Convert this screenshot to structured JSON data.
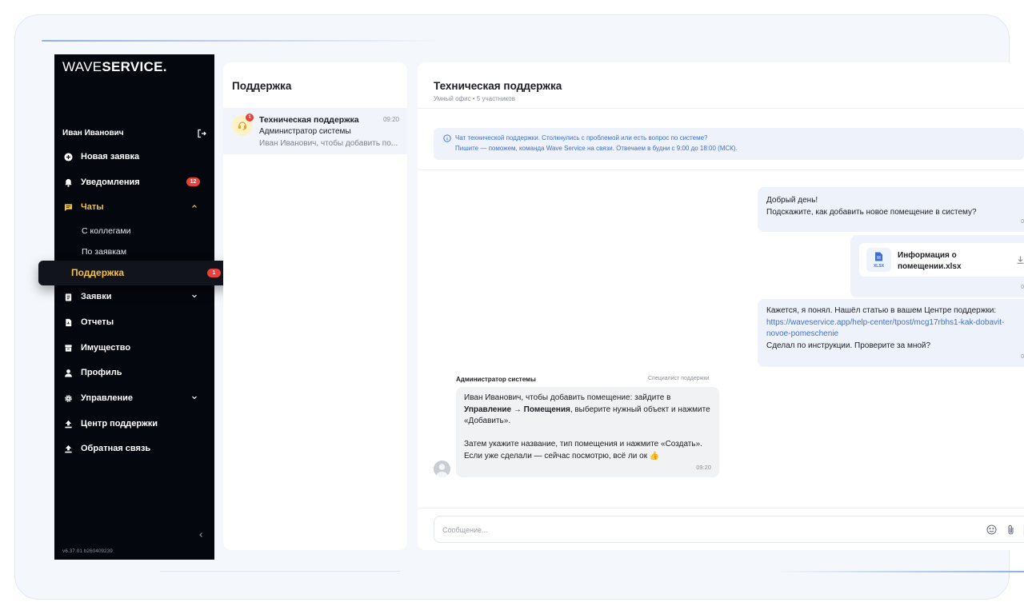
{
  "app": {
    "logo_light": "WAVE",
    "logo_bold": "SERVICE.",
    "version": "v6.37.01 b260409239"
  },
  "sidebar": {
    "user_name": "Иван Иванович",
    "items": [
      {
        "label": "Новая заявка",
        "icon": "plus-circle-icon"
      },
      {
        "label": "Уведомления",
        "icon": "bell-icon",
        "badge": "12"
      },
      {
        "label": "Чаты",
        "icon": "chat-icon",
        "expanded": true
      },
      {
        "label": "Заявки",
        "icon": "clipboard-icon"
      },
      {
        "label": "Отчеты",
        "icon": "report-icon"
      },
      {
        "label": "Имущество",
        "icon": "archive-icon"
      },
      {
        "label": "Профиль",
        "icon": "user-icon"
      },
      {
        "label": "Управление",
        "icon": "gear-icon"
      },
      {
        "label": "Центр поддержки",
        "icon": "upload-icon"
      },
      {
        "label": "Обратная связь",
        "icon": "upload-icon"
      }
    ],
    "chat_subitems": [
      {
        "label": "С коллегами"
      },
      {
        "label": "По заявкам"
      },
      {
        "label": "Поддержка",
        "badge": "1",
        "active": true
      }
    ]
  },
  "chat_list": {
    "title": "Поддержка",
    "items": [
      {
        "name": "Техническая поддержка",
        "time": "09:20",
        "subtitle": "Администратор системы",
        "preview": "Иван Иванович, чтобы добавить по...",
        "unread": "1"
      }
    ]
  },
  "chat": {
    "title": "Техническая поддержка",
    "subtitle": "Умный офис • 5 участников",
    "notice_line1": "Чат технической поддержки. Столкнулись с проблемой или есть вопрос по системе?",
    "notice_line2": "Пишите — поможем, команда Wave Service на связи. Отвечаем в будни с 9:00 до 18:00 (МСК).",
    "messages": [
      {
        "line1": "Добрый день!",
        "line2": "Подскажите, как добавить новое помещение в систему?",
        "time": "0"
      },
      {
        "file_name_1": "Информация о",
        "file_name_2": "помещении.xlsx",
        "file_ext": "XLSX",
        "time": "0"
      },
      {
        "text_before": "Кажется, я понял. Нашёл статью в вашем Центре поддержки: ",
        "link": "https://waveservice.app/help-center/tpost/mcg17rbhs1-kak-dobavit-novoe-pomeschenie",
        "text_after": "Сделал по инструкции. Проверите за мной?",
        "time": "0"
      }
    ],
    "reply": {
      "sender": "Администратор системы",
      "role": "Специалист поддержки",
      "p1_a": "Иван Иванович, чтобы добавить помещение: зайдите в ",
      "p1_bold": "Управление → Помещения",
      "p1_b": ", выберите нужный объект и нажмите «Добавить».",
      "p2": "Затем укажите название, тип помещения и нажмите «Создать». Если уже сделали — сейчас посмотрю, всё ли ок 👍",
      "time": "09:20"
    },
    "input_placeholder": "Сообщение..."
  },
  "colors": {
    "accent": "#f6c33d",
    "sidebar_bg": "#05070e",
    "badge": "#e8403b",
    "link": "#3f6fd1"
  }
}
